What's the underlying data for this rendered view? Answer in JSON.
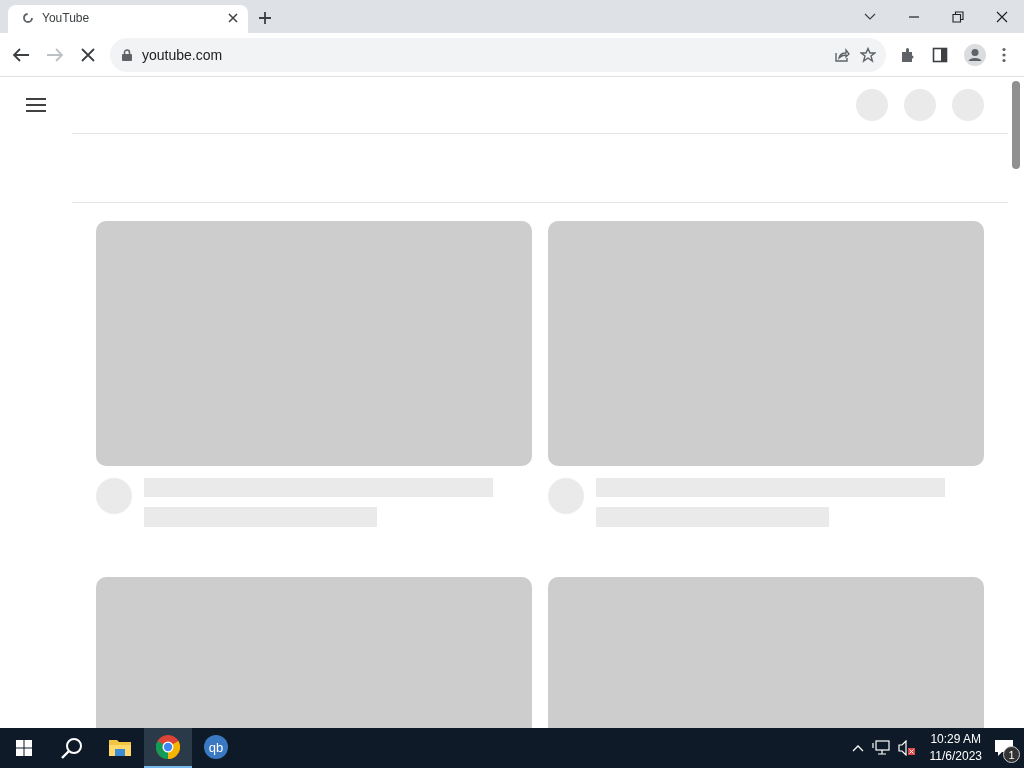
{
  "browser": {
    "tabs": [
      {
        "title": "YouTube",
        "selected": true,
        "loading": true
      }
    ],
    "address": "youtube.com",
    "loading": true
  },
  "page": {
    "header_placeholders": [
      {
        "kind": "circle"
      },
      {
        "kind": "circle"
      },
      {
        "kind": "circle"
      }
    ],
    "video_placeholders": [
      {
        "kind": "skeleton"
      },
      {
        "kind": "skeleton"
      },
      {
        "kind": "thumbnail"
      },
      {
        "kind": "thumbnail"
      }
    ]
  },
  "taskbar": {
    "apps": [
      {
        "kind": "folder",
        "selected": false
      },
      {
        "kind": "chrome",
        "selected": true
      },
      {
        "kind": "qb",
        "label": "qb",
        "selected": false
      }
    ],
    "time": "10:29 AM",
    "date": "11/6/2023",
    "notification_count": "1"
  }
}
